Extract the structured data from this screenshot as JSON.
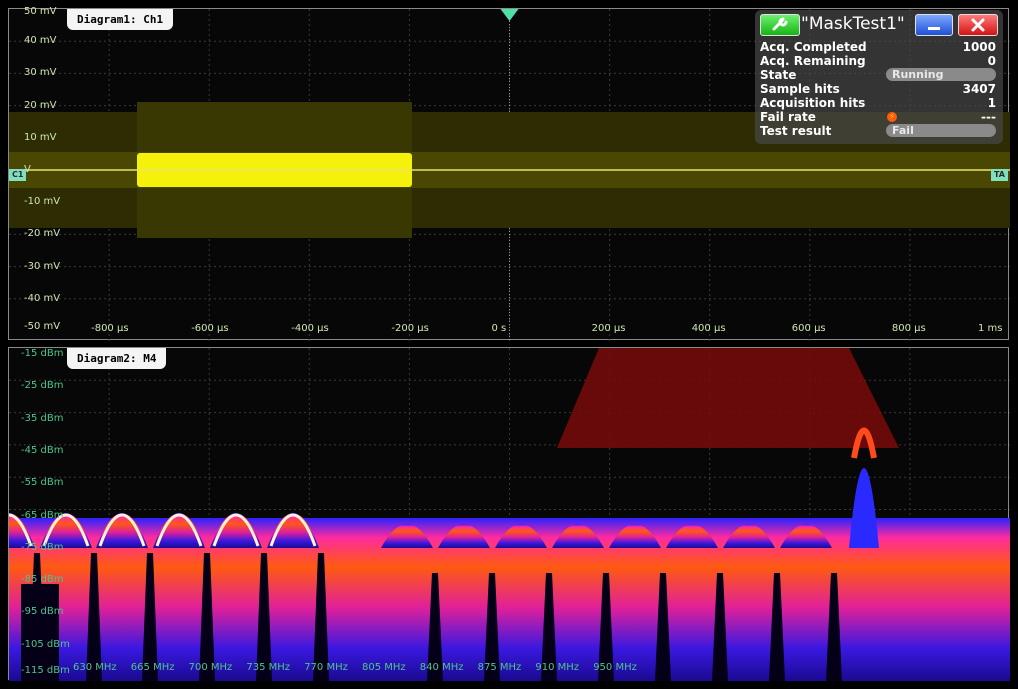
{
  "diagram1": {
    "tab_label": "Diagram1: Ch1",
    "y_labels": [
      "50 mV",
      "40 mV",
      "30 mV",
      "20 mV",
      "10 mV",
      "V",
      "-10 mV",
      "-20 mV",
      "-30 mV",
      "-40 mV",
      "-50 mV"
    ],
    "x_labels": [
      "-800 µs",
      "-600 µs",
      "-400 µs",
      "-200 µs",
      "0 s",
      "200 µs",
      "400 µs",
      "600 µs",
      "800 µs",
      "1 ms"
    ],
    "channel_marker": "C1",
    "trigger_marker": "TA",
    "trace_color": "#f5f10a"
  },
  "diagram2": {
    "tab_label": "Diagram2: M4",
    "y_labels": [
      "-15 dBm",
      "-25 dBm",
      "-35 dBm",
      "-45 dBm",
      "-55 dBm",
      "-65 dBm",
      "-75 dBm",
      "-85 dBm",
      "-95 dBm",
      "-105 dBm",
      "-115 dBm"
    ],
    "x_labels": [
      "630 MHz",
      "665 MHz",
      "700 MHz",
      "735 MHz",
      "770 MHz",
      "805 MHz",
      "840 MHz",
      "875 MHz",
      "910 MHz",
      "950 MHz"
    ],
    "mask_color": "#7a0a0a"
  },
  "mask_test": {
    "title": "\"MaskTest1\"",
    "rows": [
      {
        "key": "Acq. Completed",
        "value": "1000"
      },
      {
        "key": "Acq. Remaining",
        "value": "0"
      },
      {
        "key": "State",
        "value": "Running"
      },
      {
        "key": "Sample hits",
        "value": "3407"
      },
      {
        "key": "Acquisition hits",
        "value": "1"
      },
      {
        "key": "Fail rate",
        "value": "---"
      },
      {
        "key": "Test result",
        "value": "Fail"
      }
    ],
    "accent": "#22c322"
  }
}
